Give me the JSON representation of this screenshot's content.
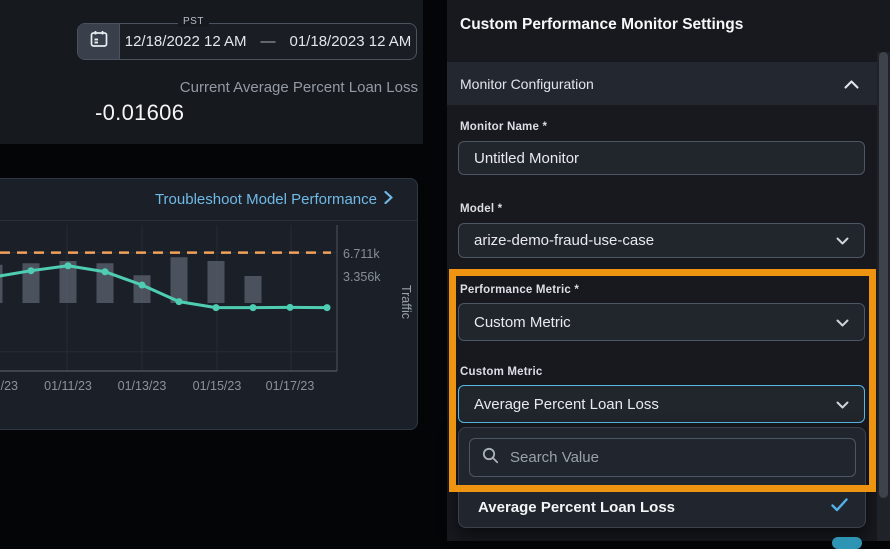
{
  "left": {
    "date_picker": {
      "timezone": "PST",
      "start": "12/18/2022 12 AM",
      "separator": "—",
      "end": "01/18/2023 12 AM"
    },
    "metric": {
      "label": "Current Average Percent Loan Loss",
      "value": "-0.01606"
    },
    "chart_card": {
      "link_label": "Troubleshoot Model Performance"
    }
  },
  "chart_data": {
    "type": "bar+line",
    "title": "",
    "x_ticks": [
      "/23",
      "01/11/23",
      "01/13/23",
      "01/15/23",
      "01/17/23"
    ],
    "bar_series": {
      "name": "Traffic",
      "dates": [
        "01/09/23",
        "01/10/23",
        "01/11/23",
        "01/12/23",
        "01/13/23",
        "01/14/23",
        "01/15/23",
        "01/16/23"
      ],
      "values_k": [
        5.1,
        5.3,
        5.6,
        5.3,
        3.7,
        6.1,
        5.6,
        3.6
      ]
    },
    "line_series": {
      "name": "Average Percent Loan Loss",
      "dates": [
        "01/09/23",
        "01/10/23",
        "01/11/23",
        "01/12/23",
        "01/13/23",
        "01/14/23",
        "01/15/23",
        "01/16/23",
        "01/17/23",
        "01/18/23"
      ],
      "values_norm": [
        0.644,
        0.687,
        0.721,
        0.68,
        0.589,
        0.475,
        0.434,
        0.434,
        0.436,
        0.434
      ]
    },
    "threshold_k": 6.711,
    "y_axis_right": {
      "label": "Traffic",
      "ticks": [
        "6.711k",
        "3.356k"
      ]
    },
    "legend": "none",
    "grid": true
  },
  "panel": {
    "title": "Custom Performance Monitor Settings",
    "section": {
      "label": "Monitor Configuration"
    },
    "fields": [
      {
        "label": "Monitor Name *",
        "value": "Untitled Monitor",
        "type": "text"
      },
      {
        "label": "Model *",
        "value": "arize-demo-fraud-use-case",
        "type": "select"
      },
      {
        "label": "Performance Metric *",
        "value": "Custom Metric",
        "type": "select"
      },
      {
        "label": "Custom Metric",
        "value": "Average Percent Loan Loss",
        "type": "select"
      }
    ],
    "dropdown": {
      "search_placeholder": "Search Value",
      "options": [
        {
          "label": "Average Percent Loan Loss",
          "selected": true
        }
      ]
    }
  },
  "colors": {
    "highlight_orange": "#EE9410",
    "focus_blue": "#56B8E4",
    "link_blue": "#6FB9E6",
    "line_teal": "#4ECDB3",
    "threshold_orange": "#F2A15A",
    "check_blue": "#53B1E8",
    "bar_gray": "#575E69",
    "panel_bg": "#17191F",
    "card_bg": "#1B2028"
  }
}
